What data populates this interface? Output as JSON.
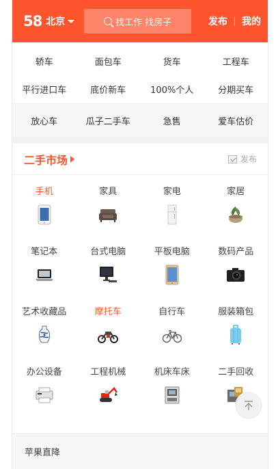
{
  "header": {
    "logo": "58",
    "city": "北京",
    "search_placeholder": "找工作 找房子",
    "post_link": "发布",
    "mine_link": "我的",
    "brand_color": "#ff552e"
  },
  "quick_links_row1": [
    "轿车",
    "面包车",
    "货车",
    "工程车"
  ],
  "quick_links_row2": [
    "平行进口车",
    "底价新车",
    "100%个人",
    "分期买车"
  ],
  "quick_links_row3": [
    "放心车",
    "瓜子二手车",
    "急售",
    "爱车估价"
  ],
  "market": {
    "title": "二手市场",
    "post_label": "发布"
  },
  "categories": [
    {
      "label": "手机",
      "icon": "phone-icon",
      "highlight": true
    },
    {
      "label": "家具",
      "icon": "sofa-icon",
      "highlight": false
    },
    {
      "label": "家电",
      "icon": "fridge-icon",
      "highlight": false
    },
    {
      "label": "家居",
      "icon": "plant-pot-icon",
      "highlight": false
    },
    {
      "label": "笔记本",
      "icon": "laptop-icon",
      "highlight": false
    },
    {
      "label": "台式电脑",
      "icon": "desktop-icon",
      "highlight": false
    },
    {
      "label": "平板电脑",
      "icon": "tablet-icon",
      "highlight": false
    },
    {
      "label": "数码产品",
      "icon": "camera-icon",
      "highlight": false
    },
    {
      "label": "艺术收藏品",
      "icon": "vase-icon",
      "highlight": false
    },
    {
      "label": "摩托车",
      "icon": "motorcycle-icon",
      "highlight": true
    },
    {
      "label": "自行车",
      "icon": "bicycle-icon",
      "highlight": false
    },
    {
      "label": "服装箱包",
      "icon": "suitcase-icon",
      "highlight": false
    },
    {
      "label": "办公设备",
      "icon": "printer-icon",
      "highlight": false
    },
    {
      "label": "工程机械",
      "icon": "excavator-icon",
      "highlight": false
    },
    {
      "label": "机床车床",
      "icon": "machine-icon",
      "highlight": false
    },
    {
      "label": "二手回收",
      "icon": "recycle-icon",
      "highlight": false
    }
  ],
  "bottom_bar": {
    "label": "苹果直降"
  }
}
